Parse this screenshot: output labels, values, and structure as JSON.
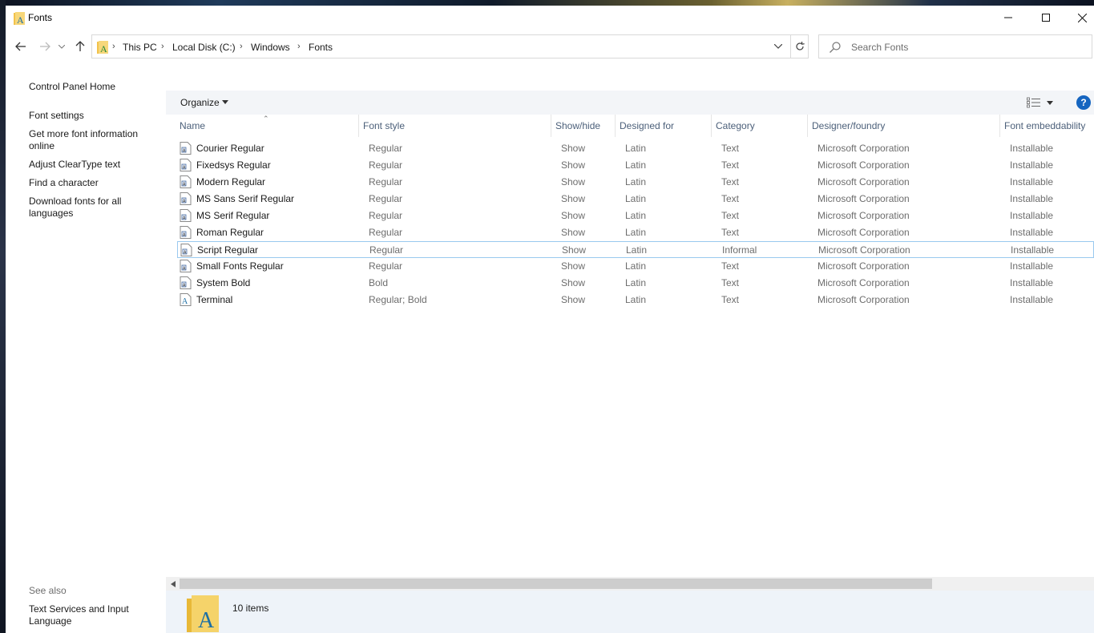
{
  "window": {
    "title": "Fonts",
    "minimize_icon": "minimize-icon",
    "maximize_icon": "maximize-icon",
    "close_icon": "close-icon"
  },
  "navigation": {
    "back_icon": "arrow-left-icon",
    "forward_icon": "arrow-right-icon",
    "recent_icon": "chevron-down-icon",
    "up_icon": "arrow-up-icon"
  },
  "address": {
    "breadcrumbs": [
      "This PC",
      "Local Disk (C:)",
      "Windows",
      "Fonts"
    ],
    "refresh_icon": "refresh-icon",
    "dropdown_icon": "chevron-down-icon"
  },
  "search": {
    "placeholder": "Search Fonts"
  },
  "sidebar": {
    "links": [
      "Control Panel Home",
      "Font settings",
      "Get more font information online",
      "Adjust ClearType text",
      "Find a character",
      "Download fonts for all languages"
    ],
    "see_also_label": "See also",
    "see_also_links": [
      "Text Services and Input Language"
    ]
  },
  "toolbar": {
    "organize_label": "Organize",
    "help_label": "?"
  },
  "table": {
    "columns": [
      "Name",
      "Font style",
      "Show/hide",
      "Designed for",
      "Category",
      "Designer/foundry",
      "Font embeddability"
    ],
    "rows": [
      [
        "Courier Regular",
        "Regular",
        "Show",
        "Latin",
        "Text",
        "Microsoft Corporation",
        "Installable"
      ],
      [
        "Fixedsys Regular",
        "Regular",
        "Show",
        "Latin",
        "Text",
        "Microsoft Corporation",
        "Installable"
      ],
      [
        "Modern Regular",
        "Regular",
        "Show",
        "Latin",
        "Text",
        "Microsoft Corporation",
        "Installable"
      ],
      [
        "MS Sans Serif Regular",
        "Regular",
        "Show",
        "Latin",
        "Text",
        "Microsoft Corporation",
        "Installable"
      ],
      [
        "MS Serif Regular",
        "Regular",
        "Show",
        "Latin",
        "Text",
        "Microsoft Corporation",
        "Installable"
      ],
      [
        "Roman Regular",
        "Regular",
        "Show",
        "Latin",
        "Text",
        "Microsoft Corporation",
        "Installable"
      ],
      [
        "Script Regular",
        "Regular",
        "Show",
        "Latin",
        "Informal",
        "Microsoft Corporation",
        "Installable"
      ],
      [
        "Small Fonts Regular",
        "Regular",
        "Show",
        "Latin",
        "Text",
        "Microsoft Corporation",
        "Installable"
      ],
      [
        "System Bold",
        "Bold",
        "Show",
        "Latin",
        "Text",
        "Microsoft Corporation",
        "Installable"
      ],
      [
        "Terminal",
        "Regular; Bold",
        "Show",
        "Latin",
        "Text",
        "Microsoft Corporation",
        "Installable"
      ]
    ],
    "selected_row": 6
  },
  "status": {
    "item_count": "10 items"
  },
  "colors": {
    "accent": "#1565c0",
    "header_text": "#4c607a",
    "selection_border": "#99c9ef",
    "toolbar_bg": "#f3f5f8",
    "details_bg": "#eef3f9"
  }
}
